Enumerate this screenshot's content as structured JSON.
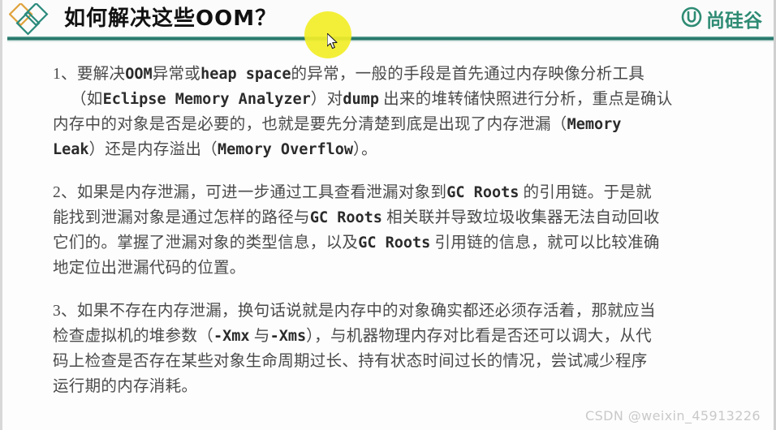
{
  "slide": {
    "title": "如何解决这些OOM？",
    "brand_name": "尚硅谷",
    "logo_icon": "diamonds-logo-icon",
    "brand_icon": "u-circle-icon",
    "accent_color": "#2a7f72",
    "title_color": "#111111",
    "body_text_color": "#4a4a4a",
    "highlight_color": "#f2ee28"
  },
  "body": {
    "paragraphs": [
      {
        "marker": "1、",
        "lines": [
          {
            "indent": false,
            "runs": [
              {
                "t": "serif",
                "v": "1、"
              },
              {
                "t": "serif",
                "v": "要解决"
              },
              {
                "t": "mono",
                "v": "OOM"
              },
              {
                "t": "serif",
                "v": "异常或"
              },
              {
                "t": "mono",
                "v": "heap space"
              },
              {
                "t": "serif",
                "v": "的异常，一般的手段是首先通过内存映像分析工具"
              }
            ]
          },
          {
            "indent": true,
            "runs": [
              {
                "t": "serif",
                "v": "（如"
              },
              {
                "t": "mono",
                "v": "Eclipse Memory Analyzer"
              },
              {
                "t": "serif",
                "v": "）对"
              },
              {
                "t": "mono",
                "v": "dump"
              },
              {
                "t": "serif",
                "v": " 出来的堆转储快照进行分析，重点是确认"
              }
            ]
          },
          {
            "indent": false,
            "runs": [
              {
                "t": "serif",
                "v": "内存中的对象是否是必要的，也就是要先分清楚到底是出现了内存泄漏（"
              },
              {
                "t": "mono",
                "v": "Memory"
              }
            ]
          },
          {
            "indent": false,
            "runs": [
              {
                "t": "mono",
                "v": "Leak"
              },
              {
                "t": "serif",
                "v": "）还是内存溢出（"
              },
              {
                "t": "mono",
                "v": "Memory Overflow"
              },
              {
                "t": "serif",
                "v": "）。"
              }
            ]
          }
        ]
      },
      {
        "marker": "2、",
        "lines": [
          {
            "indent": false,
            "runs": [
              {
                "t": "serif",
                "v": "2、"
              },
              {
                "t": "serif",
                "v": "如果是内存泄漏，可进一步通过工具查看泄漏对象到"
              },
              {
                "t": "mono",
                "v": "GC Roots"
              },
              {
                "t": "serif",
                "v": " 的引用链。于是就"
              }
            ]
          },
          {
            "indent": false,
            "runs": [
              {
                "t": "serif",
                "v": "能找到泄漏对象是通过怎样的路径与"
              },
              {
                "t": "mono",
                "v": "GC Roots"
              },
              {
                "t": "serif",
                "v": " 相关联并导致垃圾收集器无法自动回收"
              }
            ]
          },
          {
            "indent": false,
            "runs": [
              {
                "t": "serif",
                "v": "它们的。掌握了泄漏对象的类型信息，以及"
              },
              {
                "t": "mono",
                "v": "GC Roots"
              },
              {
                "t": "serif",
                "v": " 引用链的信息，就可以比较准确"
              }
            ]
          },
          {
            "indent": false,
            "runs": [
              {
                "t": "serif",
                "v": "地定位出泄漏代码的位置。"
              }
            ]
          }
        ]
      },
      {
        "marker": "3、",
        "lines": [
          {
            "indent": false,
            "runs": [
              {
                "t": "serif",
                "v": "3、"
              },
              {
                "t": "serif",
                "v": "如果不存在内存泄漏，换句话说就是内存中的对象确实都还必须存活着，那就应当"
              }
            ]
          },
          {
            "indent": false,
            "runs": [
              {
                "t": "serif",
                "v": "检查虚拟机的堆参数（"
              },
              {
                "t": "mono",
                "v": "-Xmx"
              },
              {
                "t": "serif",
                "v": " 与"
              },
              {
                "t": "mono",
                "v": "-Xms"
              },
              {
                "t": "serif",
                "v": "），与机器物理内存对比看是否还可以调大，从代"
              }
            ]
          },
          {
            "indent": false,
            "runs": [
              {
                "t": "serif",
                "v": "码上检查是否存在某些对象生命周期过长、持有状态时间过长的情况，尝试减少程序"
              }
            ]
          },
          {
            "indent": false,
            "runs": [
              {
                "t": "serif",
                "v": "运行期的内存消耗。"
              }
            ]
          }
        ]
      }
    ]
  },
  "cursor": {
    "icon": "mouse-pointer-icon",
    "highlight_icon": "click-highlight-icon"
  },
  "watermark": {
    "text": "CSDN @weixin_45913226"
  }
}
